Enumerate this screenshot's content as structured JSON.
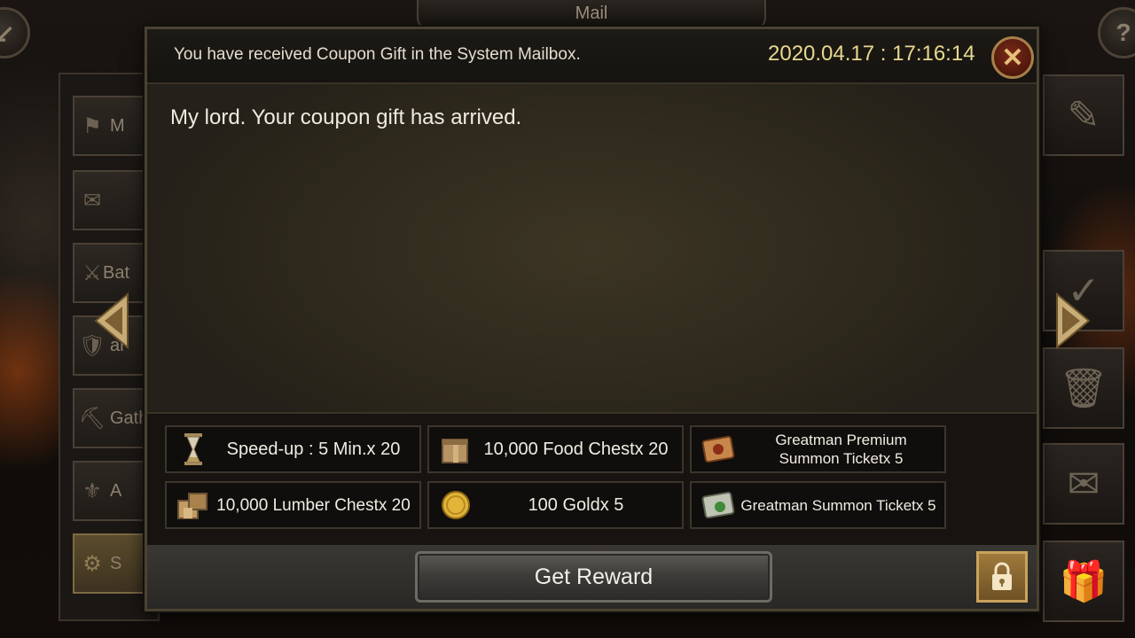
{
  "screen": {
    "title": "Mail"
  },
  "mail": {
    "subject": "You have received Coupon Gift in the System Mailbox.",
    "date": "2020.04.17 : 17:16:14",
    "body": "My lord. Your coupon gift has arrived."
  },
  "rewards": [
    {
      "label": "Speed-up : 5 Min.x 20",
      "icon": "hourglass-icon"
    },
    {
      "label": "10,000 Food Chestx 20",
      "icon": "food-chest-icon"
    },
    {
      "label": "Greatman Premium Summon Ticketx 5",
      "icon": "premium-scroll-icon"
    },
    {
      "label": "10,000 Lumber Chestx 20",
      "icon": "lumber-chest-icon"
    },
    {
      "label": "100 Goldx 5",
      "icon": "gold-coin-icon"
    },
    {
      "label": "Greatman Summon Ticketx 5",
      "icon": "scroll-icon"
    }
  ],
  "footer": {
    "get_reward_label": "Get Reward"
  },
  "left_menu": [
    {
      "label": "M",
      "icon": "flag-icon"
    },
    {
      "label": "",
      "icon": "envelope-icon"
    },
    {
      "label": "Bat",
      "icon": "crossed-swords-icon"
    },
    {
      "label": "ar",
      "icon": "shield-icon"
    },
    {
      "label": "Gath",
      "icon": "pickaxe-icon"
    },
    {
      "label": "A",
      "icon": "fleur-de-lis-icon"
    },
    {
      "label": "S",
      "icon": "gear-icon"
    }
  ],
  "right_menu": [
    "write-icon",
    "check-icon",
    "trash-icon",
    "envelope-icon",
    "gift-icon"
  ]
}
